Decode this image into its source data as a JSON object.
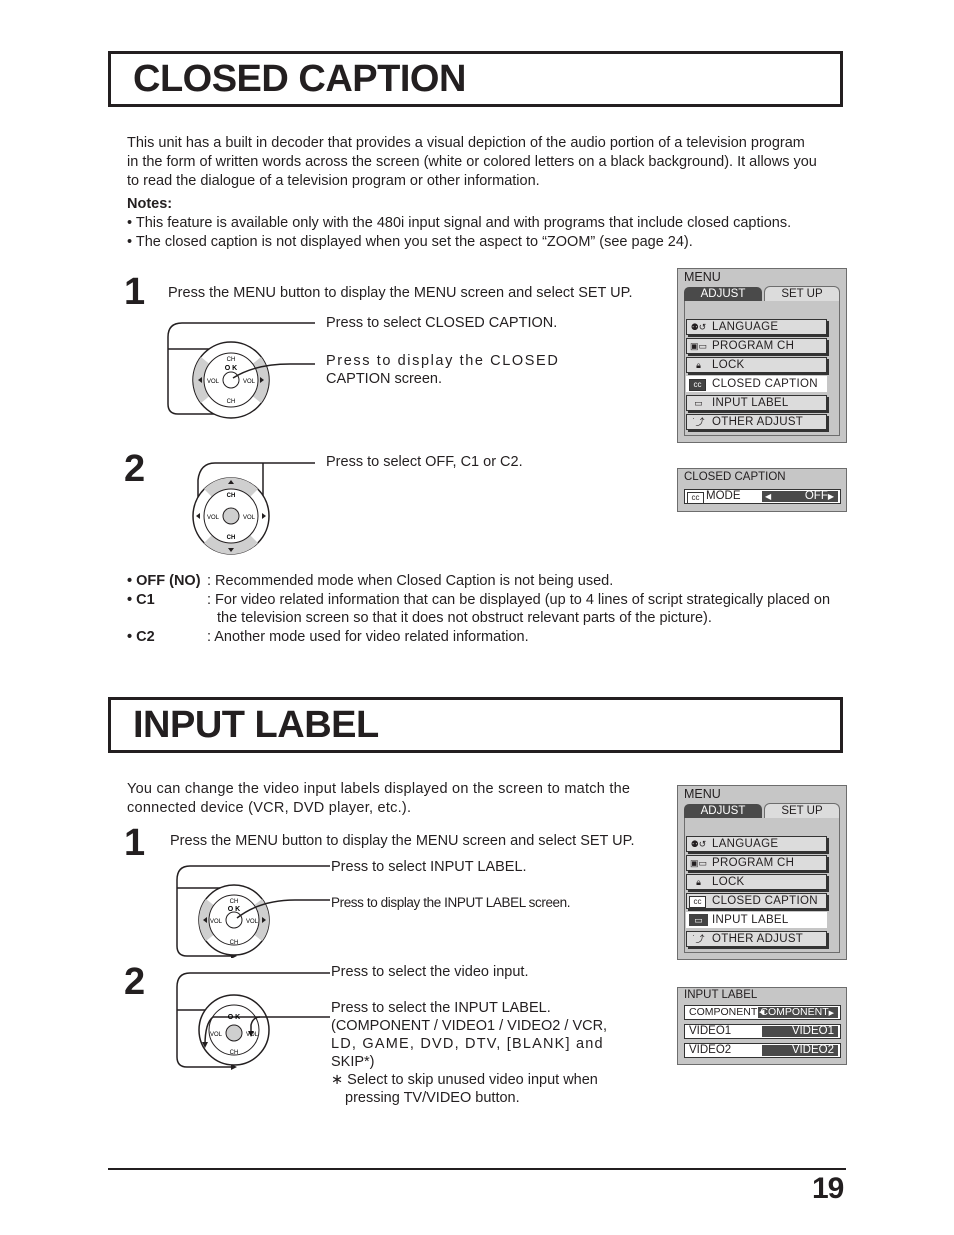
{
  "page_number": "19",
  "closed_caption": {
    "title": "CLOSED CAPTION",
    "intro": [
      "This unit has a built in decoder that provides a visual depiction of the audio portion of a television program",
      "in the form of written words across the screen (white or colored letters on a black background). It allows you",
      "to read the dialogue of a television program or other information."
    ],
    "notes_label": "Notes:",
    "notes": [
      "• This feature is available only with the 480i input signal and with programs that include closed captions.",
      "• The closed caption is not displayed when you set the aspect to “ZOOM” (see page 24)."
    ],
    "step1": {
      "number": "1",
      "text": "Press the MENU button to display the MENU screen and select SET UP.",
      "callout_select": "Press to select CLOSED CAPTION.",
      "callout_display_1": "Press  to  display  the  CLOSED",
      "callout_display_2": "CAPTION screen."
    },
    "step2": {
      "number": "2",
      "callout_select": "Press to select OFF, C1 or C2."
    },
    "modes": [
      {
        "name": "• OFF (NO)",
        "desc": ": Recommended mode when Closed Caption is not being used."
      },
      {
        "name": "• C1",
        "desc": ": For video related information that can be displayed (up to 4 lines of script strategically placed on",
        "desc2": "the television screen so that it does not obstruct relevant parts of the picture)."
      },
      {
        "name": "• C2",
        "desc": ": Another mode used for video related information."
      }
    ],
    "menu": {
      "header": "MENU",
      "tab_adjust": "ADJUST",
      "tab_setup": "SET  UP",
      "items": [
        {
          "icon": "language-icon",
          "label": "LANGUAGE"
        },
        {
          "icon": "program-ch-icon",
          "label": "PROGRAM  CH"
        },
        {
          "icon": "lock-icon",
          "label": "LOCK"
        },
        {
          "icon": "cc-icon",
          "label": "CLOSED  CAPTION",
          "selected": true
        },
        {
          "icon": "input-label-icon",
          "label": "INPUT  LABEL"
        },
        {
          "icon": "other-adjust-icon",
          "label": "OTHER  ADJUST"
        }
      ]
    },
    "cc_screen": {
      "header": "CLOSED  CAPTION",
      "row_label": "MODE",
      "row_value": "OFF"
    }
  },
  "input_label": {
    "title": "INPUT LABEL",
    "intro": [
      "You can change the video input labels displayed on the screen to match the",
      "connected device (VCR, DVD player, etc.)."
    ],
    "step1": {
      "number": "1",
      "text": "Press the MENU button to display the MENU screen and select SET UP.",
      "callout_select": "Press to select INPUT LABEL.",
      "callout_display": "Press to display the INPUT LABEL screen."
    },
    "step2": {
      "number": "2",
      "callout_select": "Press to select the video input.",
      "callout_label": [
        "Press to select the INPUT LABEL.",
        "(COMPONENT / VIDEO1 / VIDEO2 /  VCR,",
        "LD,  GAME,  DVD,  DTV,  [BLANK]  and",
        "SKIP*)"
      ],
      "footnote": [
        "∗ Select to skip unused video input when",
        "pressing TV/VIDEO button."
      ]
    },
    "menu": {
      "header": "MENU",
      "tab_adjust": "ADJUST",
      "tab_setup": "SET  UP",
      "items": [
        {
          "icon": "language-icon",
          "label": "LANGUAGE"
        },
        {
          "icon": "program-ch-icon",
          "label": "PROGRAM  CH"
        },
        {
          "icon": "lock-icon",
          "label": "LOCK"
        },
        {
          "icon": "cc-icon",
          "label": "CLOSED  CAPTION"
        },
        {
          "icon": "input-label-icon",
          "label": "INPUT  LABEL",
          "selected": true
        },
        {
          "icon": "other-adjust-icon",
          "label": "OTHER  ADJUST"
        }
      ]
    },
    "label_screen": {
      "header": "INPUT  LABEL",
      "rows": [
        {
          "input": "COMPONENT",
          "label": "COMPONENT"
        },
        {
          "input": "VIDEO1",
          "label": "VIDEO1"
        },
        {
          "input": "VIDEO2",
          "label": "VIDEO2"
        }
      ]
    }
  },
  "remote": {
    "ch": "CH",
    "ok": "O K",
    "vol": "VOL"
  }
}
